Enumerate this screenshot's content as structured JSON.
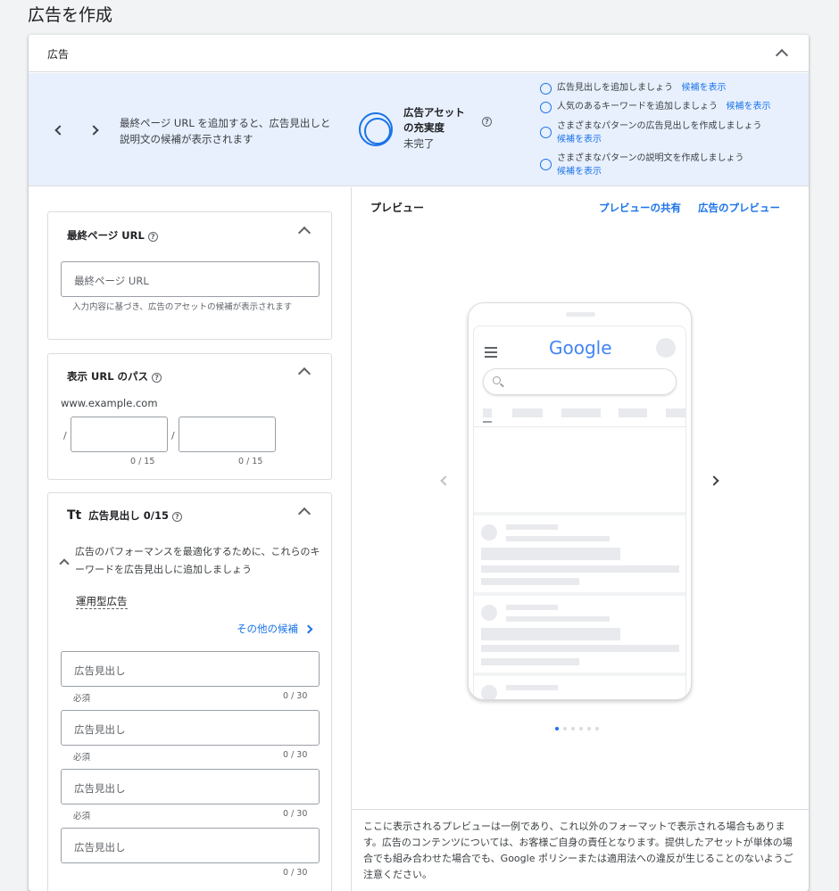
{
  "page_title": "広告を作成",
  "card": {
    "header_label": "広告",
    "banner": {
      "message": "最終ページ URL を追加すると、広告見出しと説明文の候補が表示されます",
      "strength_title": "広告アセットの充実度",
      "strength_status": "未完了",
      "suggestions": [
        {
          "text": "広告見出しを追加しましょう",
          "link": "候補を表示"
        },
        {
          "text": "人気のあるキーワードを追加しましょう",
          "link": "候補を表示"
        },
        {
          "text": "さまざまなパターンの広告見出しを作成しましょう",
          "link": "候補を表示"
        },
        {
          "text": "さまざまなパターンの説明文を作成しましょう",
          "link": "候補を表示"
        }
      ]
    },
    "final_url": {
      "title": "最終ページ URL",
      "placeholder": "最終ページ URL",
      "hint": "入力内容に基づき、広告のアセットの候補が表示されます"
    },
    "display_path": {
      "title": "表示 URL のパス",
      "domain": "www.example.com",
      "separator": "/",
      "counter1": "0 / 15",
      "counter2": "0 / 15"
    },
    "headlines": {
      "title": "広告見出し 0/15",
      "tt_icon": "Tt",
      "keyword_prompt": "広告のパフォーマンスを最適化するために、これらのキーワードを広告見出しに追加しましょう",
      "keyword": "運用型広告",
      "more_label": "その他の候補",
      "fields": [
        {
          "placeholder": "広告見出し",
          "required": "必須",
          "counter": "0 / 30"
        },
        {
          "placeholder": "広告見出し",
          "required": "必須",
          "counter": "0 / 30"
        },
        {
          "placeholder": "広告見出し",
          "required": "必須",
          "counter": "0 / 30"
        },
        {
          "placeholder": "広告見出し",
          "required": "",
          "counter": "0 / 30"
        }
      ]
    },
    "preview": {
      "title": "プレビュー",
      "share_label": "プレビューの共有",
      "preview_label": "広告のプレビュー",
      "google_logo": "Google",
      "disclaimer": "ここに表示されるプレビューは一例であり、これ以外のフォーマットで表示される場合もあります。広告のコンテンツについては、お客様ご自身の責任となります。提供したアセットが単体の場合でも組み合わせた場合でも、Google ポリシーまたは適用法への違反が生じることのないようご注意ください。",
      "carousel_count": 6,
      "carousel_active": 1
    }
  },
  "colors": {
    "accent": "#1a73e8",
    "banner_bg": "#e8f0fe"
  }
}
